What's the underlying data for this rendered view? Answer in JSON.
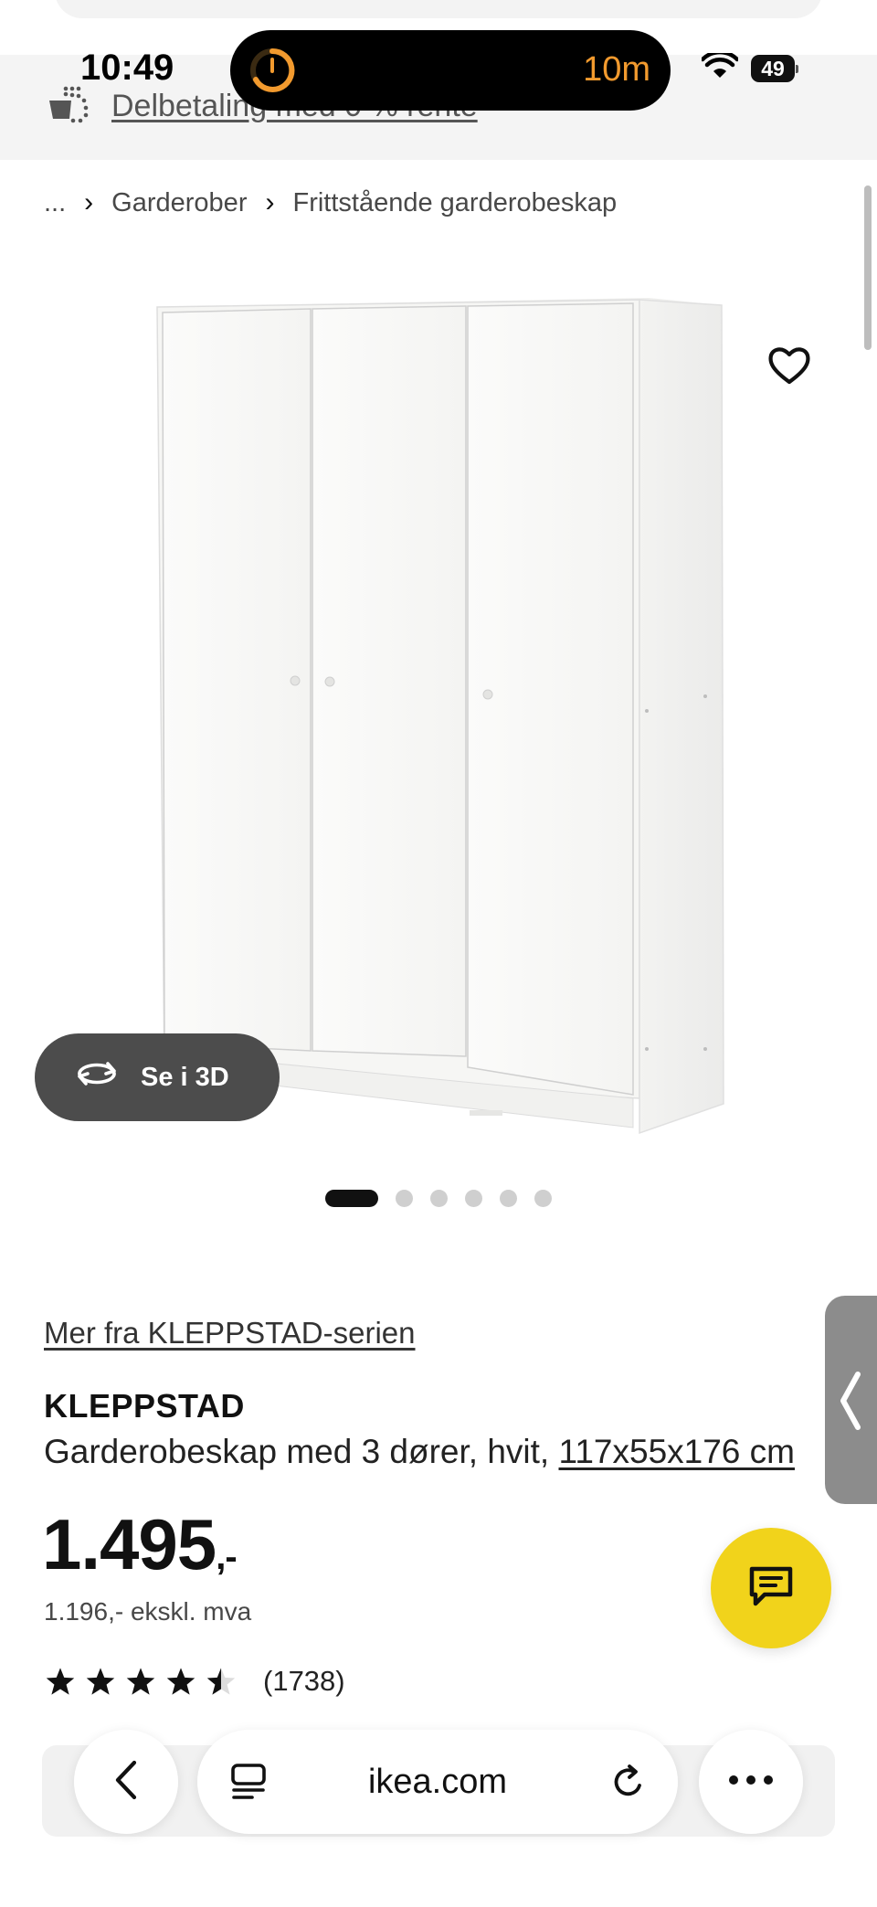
{
  "status_bar": {
    "time": "10:49",
    "timer_label": "10m",
    "battery": "49"
  },
  "promo": {
    "label": "Delbetaling med 0 % rente"
  },
  "breadcrumb": {
    "ellipsis": "...",
    "items": [
      "Garderober",
      "Frittstående garderobeskap"
    ]
  },
  "gallery": {
    "view_3d_label": "Se i 3D",
    "image_count": 6,
    "active_index": 0
  },
  "product": {
    "series_link": "Mer fra KLEPPSTAD-serien",
    "name": "KLEPPSTAD",
    "description": "Garderobeskap med 3 dører, hvit, ",
    "dimensions": "117x55x176 cm",
    "price_main": "1.495",
    "price_suffix": ",-",
    "price_ex_vat": "1.196,- ekskl. mva",
    "rating": 4.5,
    "rating_max": 5,
    "review_count": "(1738)"
  },
  "browser": {
    "url": "ikea.com"
  },
  "colors": {
    "accent_yellow": "#f1d31b",
    "timer_orange": "#f29a2e",
    "pill_dark": "#4c4c4c"
  }
}
